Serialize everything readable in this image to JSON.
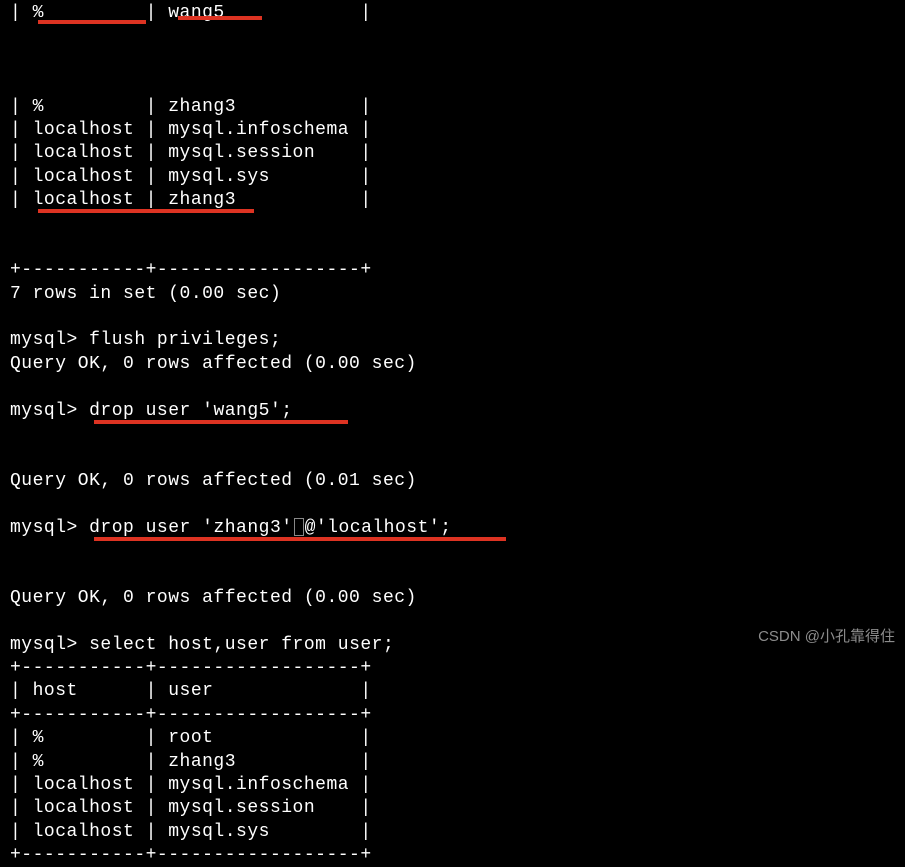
{
  "table1": {
    "rows": [
      {
        "host": "%",
        "user": "wang5"
      },
      {
        "host": "%",
        "user": "zhang3"
      },
      {
        "host": "localhost",
        "user": "mysql.infoschema"
      },
      {
        "host": "localhost",
        "user": "mysql.session"
      },
      {
        "host": "localhost",
        "user": "mysql.sys"
      },
      {
        "host": "localhost",
        "user": "zhang3"
      }
    ],
    "border": "+-----------+------------------+",
    "summary": "7 rows in set (0.00 sec)"
  },
  "cmd1": {
    "prompt": "mysql> ",
    "sql": "flush privileges;",
    "result": "Query OK, 0 rows affected (0.00 sec)"
  },
  "cmd2": {
    "prompt": "mysql> ",
    "sql": "drop user 'wang5';",
    "result": "Query OK, 0 rows affected (0.01 sec)"
  },
  "cmd3": {
    "prompt": "mysql> ",
    "sql_part1": "drop user 'zhang3'",
    "sql_at": "@",
    "sql_part2": "'localhost';",
    "result": "Query OK, 0 rows affected (0.00 sec)"
  },
  "cmd4": {
    "prompt": "mysql> ",
    "sql": "select host,user from user;"
  },
  "table2": {
    "border": "+-----------+------------------+",
    "header": "| host      | user             |",
    "rows": [
      {
        "host": "%",
        "user": "root"
      },
      {
        "host": "%",
        "user": "zhang3"
      },
      {
        "host": "localhost",
        "user": "mysql.infoschema"
      },
      {
        "host": "localhost",
        "user": "mysql.session"
      },
      {
        "host": "localhost",
        "user": "mysql.sys"
      }
    ]
  },
  "watermark": "CSDN @小孔靠得住"
}
